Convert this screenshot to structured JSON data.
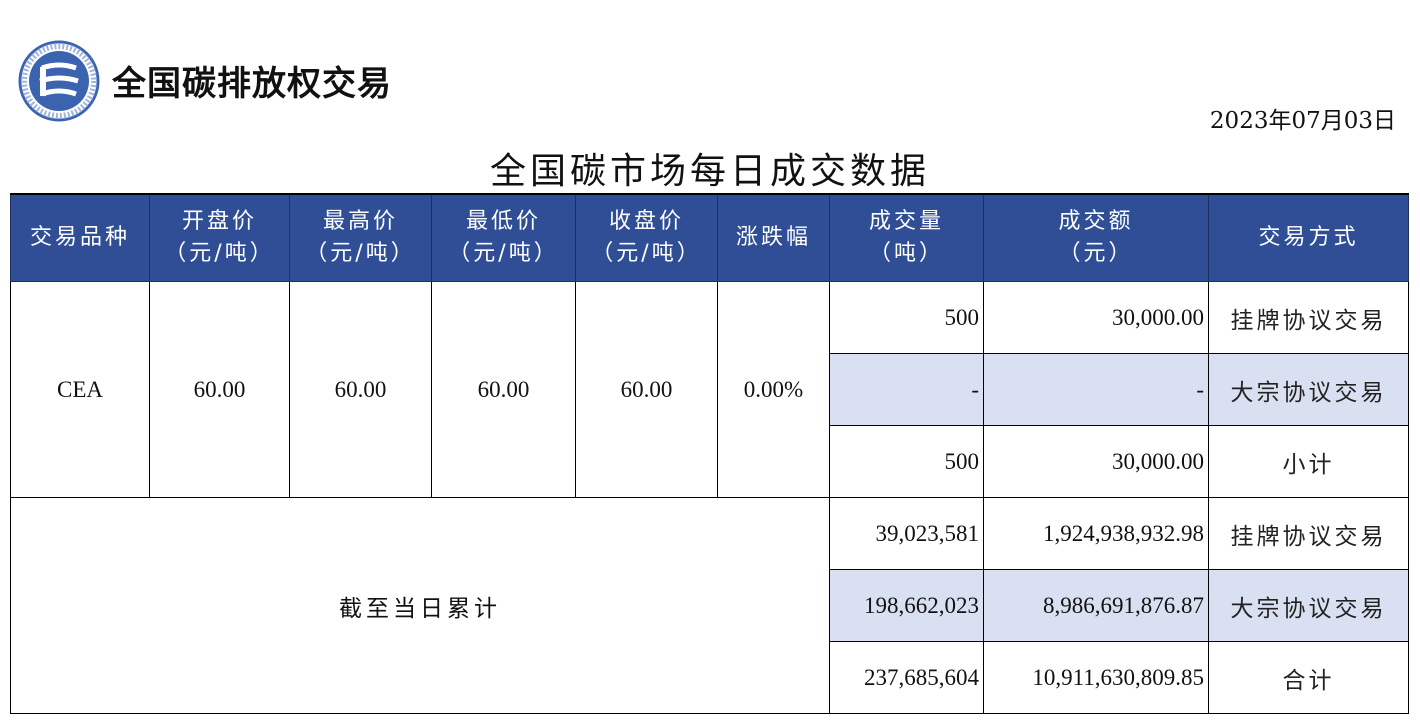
{
  "header": {
    "brand": "全国碳排放权交易",
    "date": "2023年07月03日",
    "title": "全国碳市场每日成交数据"
  },
  "colors": {
    "header_bg": "#2f4e96",
    "shade": "#d9e0f1",
    "logo": "#3b63b0"
  },
  "columns": [
    {
      "line1": "交易品种",
      "line2": ""
    },
    {
      "line1": "开盘价",
      "line2": "（元/吨）"
    },
    {
      "line1": "最高价",
      "line2": "（元/吨）"
    },
    {
      "line1": "最低价",
      "line2": "（元/吨）"
    },
    {
      "line1": "收盘价",
      "line2": "（元/吨）"
    },
    {
      "line1": "涨跌幅",
      "line2": ""
    },
    {
      "line1": "成交量",
      "line2": "（吨）"
    },
    {
      "line1": "成交额",
      "line2": "（元）"
    },
    {
      "line1": "交易方式",
      "line2": ""
    }
  ],
  "daily": {
    "product": "CEA",
    "open": "60.00",
    "high": "60.00",
    "low": "60.00",
    "close": "60.00",
    "change": "0.00%",
    "rows": [
      {
        "volume": "500",
        "amount": "30,000.00",
        "mode": "挂牌协议交易"
      },
      {
        "volume": "-",
        "amount": "-",
        "mode": "大宗协议交易"
      },
      {
        "volume": "500",
        "amount": "30,000.00",
        "mode": "小计"
      }
    ]
  },
  "cumulative": {
    "label": "截至当日累计",
    "rows": [
      {
        "volume": "39,023,581",
        "amount": "1,924,938,932.98",
        "mode": "挂牌协议交易"
      },
      {
        "volume": "198,662,023",
        "amount": "8,986,691,876.87",
        "mode": "大宗协议交易"
      },
      {
        "volume": "237,685,604",
        "amount": "10,911,630,809.85",
        "mode": "合计"
      }
    ]
  }
}
